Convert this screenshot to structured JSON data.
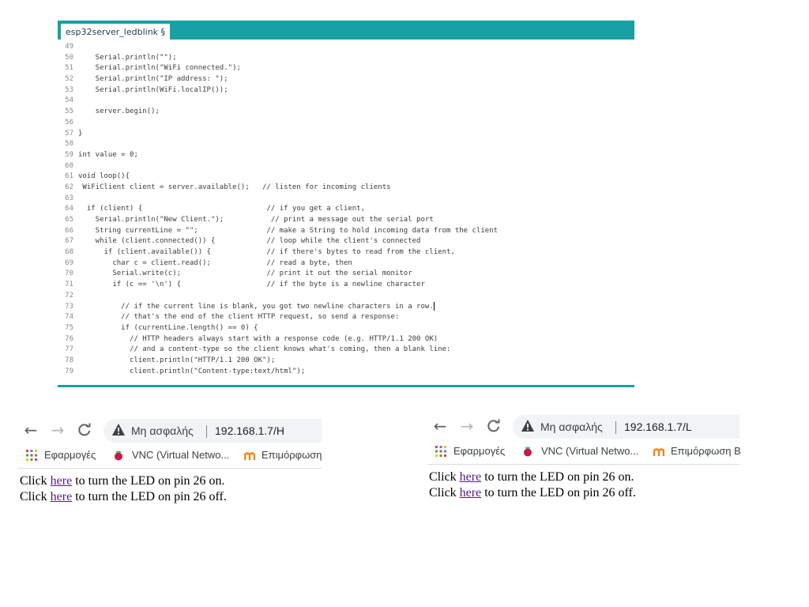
{
  "ide": {
    "tab_label": "esp32server_ledblink §",
    "code_lines": [
      {
        "num": "49",
        "text": ""
      },
      {
        "num": "50",
        "text": "    Serial.println(\"\");"
      },
      {
        "num": "51",
        "text": "    Serial.println(\"WiFi connected.\");"
      },
      {
        "num": "52",
        "text": "    Serial.println(\"IP address: \");"
      },
      {
        "num": "53",
        "text": "    Serial.println(WiFi.localIP());"
      },
      {
        "num": "54",
        "text": ""
      },
      {
        "num": "55",
        "text": "    server.begin();"
      },
      {
        "num": "56",
        "text": ""
      },
      {
        "num": "57",
        "text": "}"
      },
      {
        "num": "58",
        "text": ""
      },
      {
        "num": "59",
        "text": "int value = 0;"
      },
      {
        "num": "60",
        "text": ""
      },
      {
        "num": "61",
        "text": "void loop(){"
      },
      {
        "num": "62",
        "text": " WiFiClient client = server.available();   // listen for incoming clients"
      },
      {
        "num": "63",
        "text": ""
      },
      {
        "num": "64",
        "text": "  if (client) {                             // if you get a client,"
      },
      {
        "num": "65",
        "text": "    Serial.println(\"New Client.\");           // print a message out the serial port"
      },
      {
        "num": "66",
        "text": "    String currentLine = \"\";                // make a String to hold incoming data from the client"
      },
      {
        "num": "67",
        "text": "    while (client.connected()) {            // loop while the client's connected"
      },
      {
        "num": "68",
        "text": "      if (client.available()) {             // if there's bytes to read from the client,"
      },
      {
        "num": "69",
        "text": "        char c = client.read();             // read a byte, then"
      },
      {
        "num": "70",
        "text": "        Serial.write(c);                    // print it out the serial monitor"
      },
      {
        "num": "71",
        "text": "        if (c == '\\n') {                    // if the byte is a newline character"
      },
      {
        "num": "72",
        "text": ""
      },
      {
        "num": "73",
        "text": "          // if the current line is blank, you got two newline characters in a row."
      },
      {
        "num": "74",
        "text": "          // that's the end of the client HTTP request, so send a response:"
      },
      {
        "num": "75",
        "text": "          if (currentLine.length() == 0) {"
      },
      {
        "num": "76",
        "text": "            // HTTP headers always start with a response code (e.g. HTTP/1.1 200 OK)"
      },
      {
        "num": "77",
        "text": "            // and a content-type so the client knows what's coming, then a blank line:"
      },
      {
        "num": "78",
        "text": "            client.println(\"HTTP/1.1 200 OK\");"
      },
      {
        "num": "79",
        "text": "            client.println(\"Content-type:text/html\");"
      }
    ]
  },
  "browsers": [
    {
      "back_icon": "←",
      "forward_icon": "→",
      "reload_icon": "C",
      "security_label": "Μη ασφαλής",
      "url": "192.168.1.7/H",
      "bookmarks": [
        "Εφαρμογές",
        "VNC (Virtual Netwo...",
        "Επιμόρφωση"
      ],
      "line1": {
        "prefix": "Click ",
        "link": "here",
        "suffix": " to turn the LED on pin 26 on."
      },
      "line2": {
        "prefix": "Click ",
        "link": "here",
        "suffix": " to turn the LED on pin 26 off."
      }
    },
    {
      "back_icon": "←",
      "forward_icon": "→",
      "reload_icon": "C",
      "security_label": "Μη ασφαλής",
      "url": "192.168.1.7/L",
      "bookmarks": [
        "Εφαρμογές",
        "VNC (Virtual Netwo...",
        "Επιμόρφωση Β"
      ],
      "line1": {
        "prefix": "Click ",
        "link": "here",
        "suffix": " to turn the LED on pin 26 on."
      },
      "line2": {
        "prefix": "Click ",
        "link": "here",
        "suffix": " to turn the LED on pin 26 off."
      }
    }
  ],
  "colors": {
    "ide_accent": "#17a1a5",
    "link_visited": "#551a8b"
  }
}
